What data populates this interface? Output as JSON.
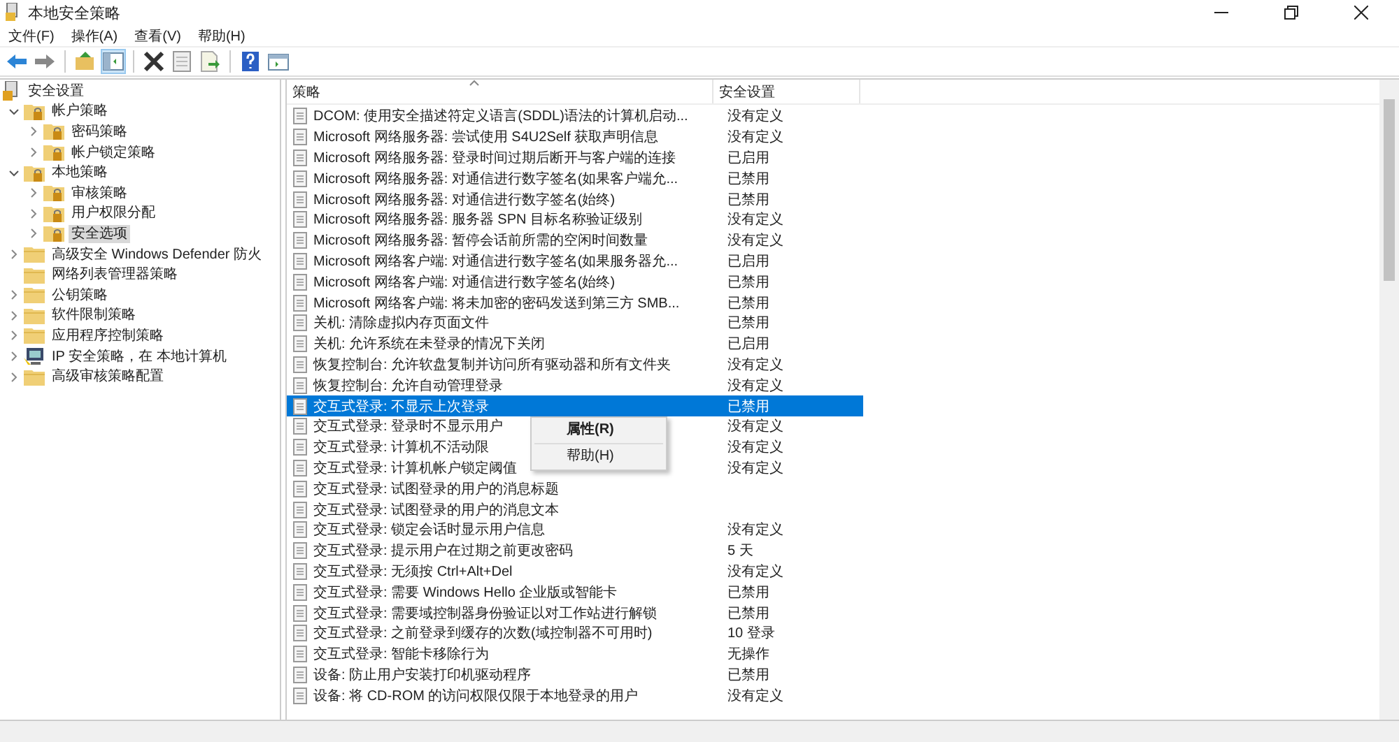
{
  "window": {
    "title": "本地安全策略"
  },
  "menu": [
    "文件(F)",
    "操作(A)",
    "查看(V)",
    "帮助(H)"
  ],
  "toolbar": [
    {
      "kind": "back",
      "pressed": false
    },
    {
      "kind": "forward",
      "pressed": false
    },
    {
      "kind": "sep"
    },
    {
      "kind": "up",
      "pressed": false
    },
    {
      "kind": "tree",
      "pressed": true
    },
    {
      "kind": "sep"
    },
    {
      "kind": "delete",
      "pressed": false
    },
    {
      "kind": "properties",
      "pressed": false
    },
    {
      "kind": "export",
      "pressed": false
    },
    {
      "kind": "sep"
    },
    {
      "kind": "help",
      "pressed": false
    },
    {
      "kind": "pane",
      "pressed": false
    }
  ],
  "tree": [
    {
      "label": "安全设置",
      "kind": "root",
      "selected": false,
      "children": [
        {
          "label": "帐户策略",
          "kind": "locked",
          "expanded": true,
          "selected": false,
          "children": [
            {
              "label": "密码策略",
              "kind": "locked",
              "expanded": false,
              "selected": false
            },
            {
              "label": "帐户锁定策略",
              "kind": "locked",
              "expanded": false,
              "selected": false
            }
          ]
        },
        {
          "label": "本地策略",
          "kind": "locked",
          "expanded": true,
          "selected": false,
          "children": [
            {
              "label": "审核策略",
              "kind": "locked",
              "expanded": false,
              "selected": false
            },
            {
              "label": "用户权限分配",
              "kind": "locked",
              "expanded": false,
              "selected": false
            },
            {
              "label": "安全选项",
              "kind": "locked",
              "expanded": false,
              "selected": true
            }
          ]
        },
        {
          "label": "高级安全 Windows Defender 防火",
          "kind": "folder",
          "expanded": false,
          "selected": false
        },
        {
          "label": "网络列表管理器策略",
          "kind": "folder",
          "selected": false
        },
        {
          "label": "公钥策略",
          "kind": "folder",
          "expanded": false,
          "selected": false
        },
        {
          "label": "软件限制策略",
          "kind": "folder",
          "expanded": false,
          "selected": false
        },
        {
          "label": "应用程序控制策略",
          "kind": "folder",
          "expanded": false,
          "selected": false
        },
        {
          "label": "IP 安全策略，在 本地计算机",
          "kind": "computer",
          "expanded": false,
          "selected": false
        },
        {
          "label": "高级审核策略配置",
          "kind": "folder",
          "expanded": false,
          "selected": false
        }
      ]
    }
  ],
  "table": {
    "columns": [
      "策略",
      "安全设置"
    ],
    "rows": [
      {
        "policy": "DCOM: 使用安全描述符定义语言(SDDL)语法的计算机启动...",
        "value": "没有定义",
        "selected": false
      },
      {
        "policy": "Microsoft 网络服务器: 尝试使用 S4U2Self 获取声明信息",
        "value": "没有定义",
        "selected": false
      },
      {
        "policy": "Microsoft 网络服务器: 登录时间过期后断开与客户端的连接",
        "value": "已启用",
        "selected": false
      },
      {
        "policy": "Microsoft 网络服务器: 对通信进行数字签名(如果客户端允...",
        "value": "已禁用",
        "selected": false
      },
      {
        "policy": "Microsoft 网络服务器: 对通信进行数字签名(始终)",
        "value": "已禁用",
        "selected": false
      },
      {
        "policy": "Microsoft 网络服务器: 服务器 SPN 目标名称验证级别",
        "value": "没有定义",
        "selected": false
      },
      {
        "policy": "Microsoft 网络服务器: 暂停会话前所需的空闲时间数量",
        "value": "没有定义",
        "selected": false
      },
      {
        "policy": "Microsoft 网络客户端: 对通信进行数字签名(如果服务器允...",
        "value": "已启用",
        "selected": false
      },
      {
        "policy": "Microsoft 网络客户端: 对通信进行数字签名(始终)",
        "value": "已禁用",
        "selected": false
      },
      {
        "policy": "Microsoft 网络客户端: 将未加密的密码发送到第三方 SMB...",
        "value": "已禁用",
        "selected": false
      },
      {
        "policy": "关机: 清除虚拟内存页面文件",
        "value": "已禁用",
        "selected": false
      },
      {
        "policy": "关机: 允许系统在未登录的情况下关闭",
        "value": "已启用",
        "selected": false
      },
      {
        "policy": "恢复控制台: 允许软盘复制并访问所有驱动器和所有文件夹",
        "value": "没有定义",
        "selected": false
      },
      {
        "policy": "恢复控制台: 允许自动管理登录",
        "value": "没有定义",
        "selected": false
      },
      {
        "policy": "交互式登录: 不显示上次登录",
        "value": "已禁用",
        "selected": true
      },
      {
        "policy": "交互式登录: 登录时不显示用户",
        "value": "没有定义",
        "selected": false
      },
      {
        "policy": "交互式登录: 计算机不活动限",
        "value": "没有定义",
        "selected": false
      },
      {
        "policy": "交互式登录: 计算机帐户锁定阈值",
        "value": "没有定义",
        "selected": false
      },
      {
        "policy": "交互式登录: 试图登录的用户的消息标题",
        "selected": false
      },
      {
        "policy": "交互式登录: 试图登录的用户的消息文本",
        "selected": false
      },
      {
        "policy": "交互式登录: 锁定会话时显示用户信息",
        "value": "没有定义",
        "selected": false
      },
      {
        "policy": "交互式登录: 提示用户在过期之前更改密码",
        "value": "5 天",
        "selected": false
      },
      {
        "policy": "交互式登录: 无须按 Ctrl+Alt+Del",
        "value": "没有定义",
        "selected": false
      },
      {
        "policy": "交互式登录: 需要 Windows Hello 企业版或智能卡",
        "value": "已禁用",
        "selected": false
      },
      {
        "policy": "交互式登录: 需要域控制器身份验证以对工作站进行解锁",
        "value": "已禁用",
        "selected": false
      },
      {
        "policy": "交互式登录: 之前登录到缓存的次数(域控制器不可用时)",
        "value": "10 登录",
        "selected": false
      },
      {
        "policy": "交互式登录: 智能卡移除行为",
        "value": "无操作",
        "selected": false
      },
      {
        "policy": "设备: 防止用户安装打印机驱动程序",
        "value": "已禁用",
        "selected": false
      },
      {
        "policy": "设备: 将 CD-ROM 的访问权限仅限于本地登录的用户",
        "value": "没有定义",
        "selected": false
      }
    ]
  },
  "context_menu": [
    {
      "label": "属性(R)",
      "default": true
    },
    {
      "label": "帮助(H)",
      "default": false
    }
  ]
}
